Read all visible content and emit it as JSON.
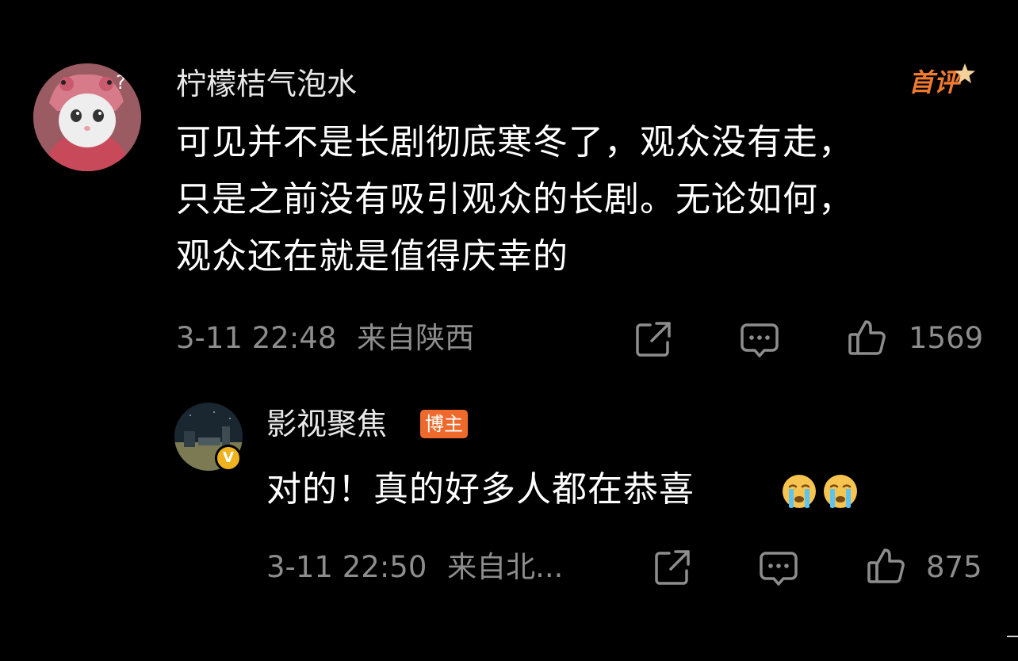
{
  "comment": {
    "username": "柠檬桔气泡水",
    "badge": "首评",
    "lines": [
      "可见并不是长剧彻底寒冬了，观众没有走，",
      "只是之前没有吸引观众的长剧。无论如何，",
      "观众还在就是值得庆幸的"
    ],
    "time": "3-11 22:48",
    "location": "来自陕西",
    "likes": "1569"
  },
  "reply": {
    "username": "影视聚焦",
    "tag": "博主",
    "text": "对的！真的好多人都在恭喜",
    "emojis": [
      "crying-face",
      "crying-face"
    ],
    "time": "3-11 22:50",
    "location": "来自北...",
    "likes": "875"
  },
  "colors": {
    "background": "#000000",
    "meta_text": "#8d8d8d",
    "accent_orange": "#ee6a2c",
    "verified_gold": "#f0b21f"
  },
  "icons": [
    "share-icon",
    "comment-icon",
    "like-icon",
    "verified-icon"
  ]
}
